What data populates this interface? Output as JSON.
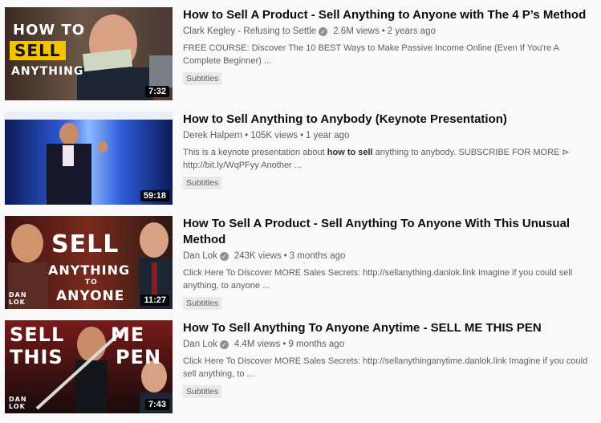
{
  "results": [
    {
      "title": "How to Sell A Product - Sell Anything to Anyone with The 4 P’s Method",
      "channel": "Clark Kegley - Refusing to Settle",
      "views": "2.6M views",
      "age": "2 years ago",
      "description": "FREE COURSE: Discover The 10 BEST Ways to Make Passive Income Online (Even If You're A Complete Beginner) ...",
      "badge": "Subtitles",
      "duration": "7:32",
      "thumb_text": [
        "HOW TO",
        "SELL",
        "ANYTHING"
      ]
    },
    {
      "title": "How to Sell Anything to Anybody (Keynote Presentation)",
      "channel": "Derek Halpern",
      "views": "105K views",
      "age": "1 year ago",
      "desc_pre": "This is a keynote presentation about ",
      "desc_bold": "how to sell",
      "desc_post": " anything to anybody. SUBSCRIBE FOR MORE ⊳ http://bit.ly/WqPFyy Another ...",
      "badge": "Subtitles",
      "duration": "59:18"
    },
    {
      "title": "How To Sell A Product - Sell Anything To Anyone With This Unusual Method",
      "channel": "Dan Lok",
      "views": "243K views",
      "age": "3 months ago",
      "description": "Click Here To Discover MORE Sales Secrets: http://sellanything.danlok.link Imagine if you could sell anything, to anyone ...",
      "badge": "Subtitles",
      "duration": "11:27",
      "thumb_text": [
        "SELL",
        "ANYTHING",
        "TO",
        "ANYONE",
        "DAN LOK"
      ]
    },
    {
      "title": "How To Sell Anything To Anyone Anytime - SELL ME THIS PEN",
      "channel": "Dan Lok",
      "views": "4.4M views",
      "age": "9 months ago",
      "description": "Click Here To Discover MORE Sales Secrets: http://sellanythinganytime.danlok.link Imagine if you could sell anything, to ...",
      "badge": "Subtitles",
      "duration": "7:43",
      "thumb_text": [
        "SELL",
        "ME",
        "THIS",
        "PEN",
        "DAN LOK"
      ]
    }
  ],
  "separator": "•",
  "icons": {
    "verified": "verified-check-icon"
  }
}
